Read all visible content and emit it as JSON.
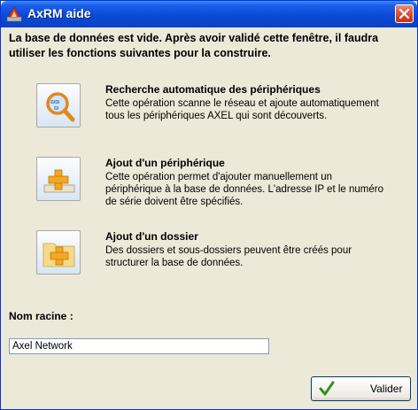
{
  "window": {
    "title": "AxRM aide",
    "app_icon": "axrm-logo-icon",
    "close_icon": "close-icon"
  },
  "intro": "La base de données est vide. Après avoir validé cette fenêtre, il faudra utiliser les fonctions suivantes pour la construire.",
  "options": [
    {
      "icon": "magnifier-network-icon",
      "title": "Recherche automatique des périphériques",
      "description": "Cette opération scanne le réseau et ajoute automatiquement tous les périphériques AXEL qui sont découverts."
    },
    {
      "icon": "add-device-icon",
      "title": "Ajout d'un périphérique",
      "description": "Cette opération permet d'ajouter manuellement un périphérique à la base de données. L'adresse IP et le numéro de série doivent être spécifiés."
    },
    {
      "icon": "add-folder-icon",
      "title": "Ajout d'un dossier",
      "description": "Des dossiers et sous-dossiers peuvent être créés pour structurer la base de données."
    }
  ],
  "root": {
    "label": "Nom racine :",
    "value": "Axel Network"
  },
  "validate": {
    "label": "Valider",
    "icon": "checkmark-icon"
  },
  "colors": {
    "titlebar": "#0b4ad7",
    "dialog_bg": "#ece9d8",
    "close_button": "#d8462b",
    "icon_orange": "#f5a623",
    "check_green": "#3a8f1e"
  }
}
